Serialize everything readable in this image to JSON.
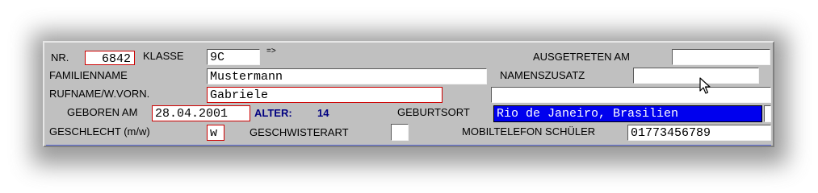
{
  "form": {
    "nr_label": "NR.",
    "nr_value": "6842",
    "klasse_label": "KLASSE",
    "klasse_value": "9C",
    "klasse_arrow": "=>",
    "ausgetreten_label": "AUSGETRETEN AM",
    "ausgetreten_value": "",
    "familienname_label": "FAMILIENNAME",
    "familienname_value": "Mustermann",
    "namenszusatz_label": "NAMENSZUSATZ",
    "namenszusatz_value": "",
    "rufname_label": "RUFNAME/W.VORN.",
    "rufname_value": "Gabriele",
    "geboren_label": "GEBOREN AM",
    "geboren_value": "28.04.2001",
    "alter_label": "ALTER:",
    "alter_value": "14",
    "geburtsort_label": "GEBURTSORT",
    "geburtsort_value": "Rio de Janeiro, Brasilien",
    "geschlecht_label": "GESCHLECHT (m/w)",
    "geschlecht_value": "w",
    "geschwisterart_label": "GESCHWISTERART",
    "geschwisterart_value": "",
    "mobil_label": "MOBILTELEFON SCHÜLER",
    "mobil_value": "01773456789"
  },
  "colors": {
    "panel": "#c0c0c0",
    "required_border": "#cc0000",
    "selection": "#0000ee",
    "alter_text": "#000080"
  },
  "icons": {
    "cursor": "mouse-pointer-icon"
  }
}
